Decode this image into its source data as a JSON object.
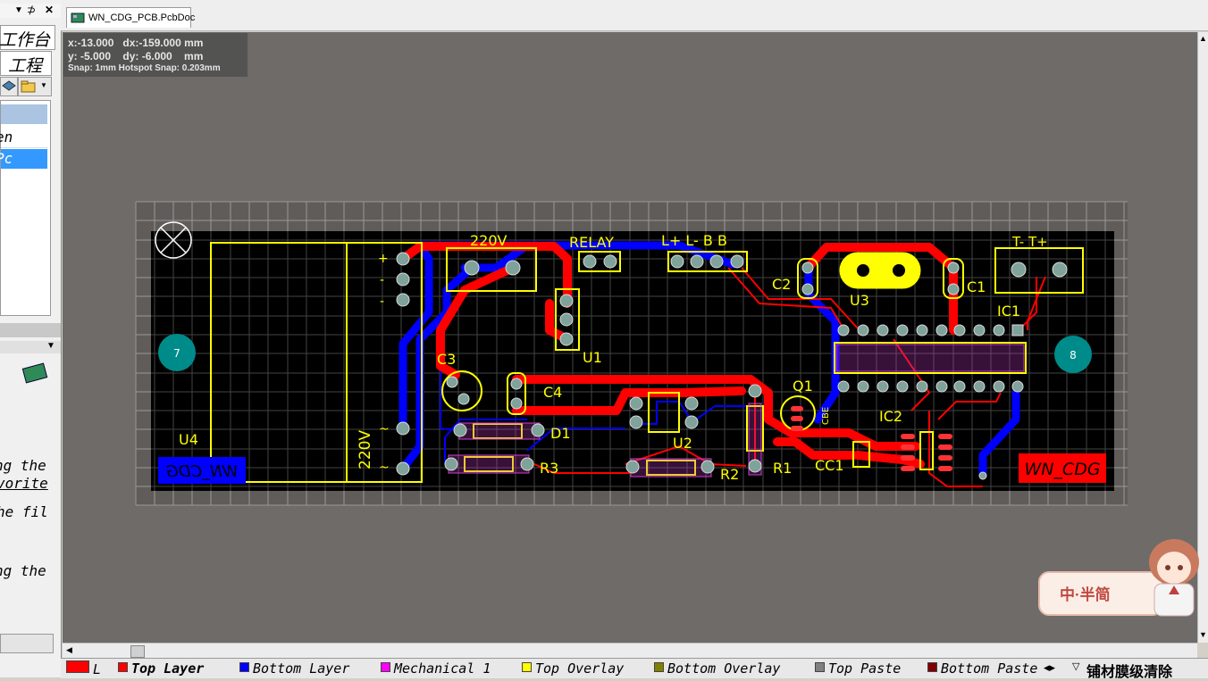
{
  "left_panel": {
    "title_cjk_1": "工作台",
    "title_cjk_2": "工程",
    "item_1": "en",
    "item_2": "Pc",
    "text_1": "ng the",
    "text_2": "vorite",
    "text_3": "he fil",
    "text_4": "ng the"
  },
  "document_tab": {
    "label": "WN_CDG_PCB.PcbDoc"
  },
  "coordinates": {
    "line1": "x:-13.000   dx:-159.000 mm",
    "line2": "y: -5.000    dy: -6.000    mm",
    "line3": "Snap: 1mm Hotspot Snap: 0.203mm"
  },
  "pcb": {
    "labels": {
      "u4": "U4",
      "ac_220_top": "220V",
      "relay": "RELAY",
      "lb": "L+  L-  B  B",
      "c2": "C2",
      "u3": "U3",
      "c1": "C1",
      "tt": "T-  T+",
      "ic1": "IC1",
      "u1": "U1",
      "c3": "C3",
      "c4": "C4",
      "q1": "Q1",
      "cbe": "CBE",
      "ic2": "IC2",
      "d1": "D1",
      "u2": "U2",
      "r3": "R3",
      "r2": "R2",
      "r1": "R1",
      "cc1": "CC1",
      "ac_220_side": "220V",
      "plus": "+",
      "minus1": "-",
      "minus2": "-",
      "tilde1": "~",
      "tilde2": "~",
      "hole7": "7",
      "hole8": "8",
      "logo_left": "WN_CDG",
      "logo_right": "WN_CDG"
    }
  },
  "layer_tabs": [
    {
      "label": "L",
      "color": "#ff0000"
    },
    {
      "label": "Top Layer",
      "color": "#ff0000"
    },
    {
      "label": "Bottom Layer",
      "color": "#0000ff"
    },
    {
      "label": "Mechanical 1",
      "color": "#ff00ff"
    },
    {
      "label": "Top Overlay",
      "color": "#ffff00"
    },
    {
      "label": "Bottom Overlay",
      "color": "#808000"
    },
    {
      "label": "Top Paste",
      "color": "#808080"
    },
    {
      "label": "Bottom Paste",
      "color": "#800000"
    }
  ],
  "status_right": "铺材膜级清除",
  "watermark": {
    "text": "中·半简"
  }
}
